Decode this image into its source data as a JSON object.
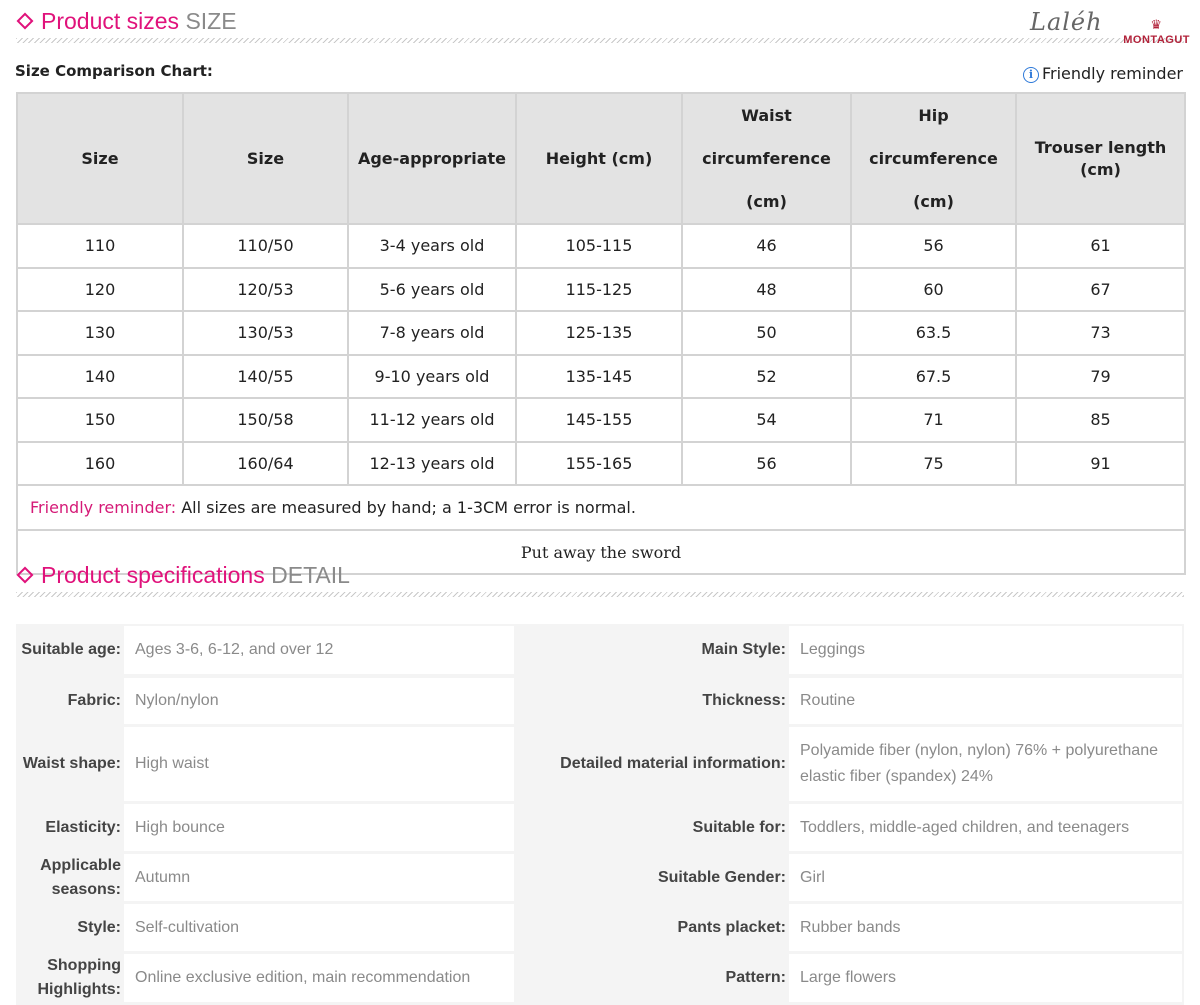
{
  "sizes_section": {
    "title_cn": "Product sizes",
    "title_en": "SIZE"
  },
  "logo": {
    "script": "Laléh",
    "brand": "MONTAGUT",
    "crown": "♛"
  },
  "chart_label": "Size Comparison Chart:",
  "reminder_tag": {
    "icon": "i",
    "label": "Friendly reminder"
  },
  "size_table": {
    "headers": [
      "Size",
      "Size",
      "Age-appropriate",
      "Height (cm)",
      "Waist circumference (cm)",
      "Hip circumference (cm)",
      "Trouser length (cm)"
    ],
    "rows": [
      [
        "110",
        "110/50",
        "3-4 years old",
        "105-115",
        "46",
        "56",
        "61"
      ],
      [
        "120",
        "120/53",
        "5-6 years old",
        "115-125",
        "48",
        "60",
        "67"
      ],
      [
        "130",
        "130/53",
        "7-8 years old",
        "125-135",
        "50",
        "63.5",
        "73"
      ],
      [
        "140",
        "140/55",
        "9-10 years old",
        "135-145",
        "52",
        "67.5",
        "79"
      ],
      [
        "150",
        "150/58",
        "11-12 years old",
        "145-155",
        "54",
        "71",
        "85"
      ],
      [
        "160",
        "160/64",
        "12-13 years old",
        "155-165",
        "56",
        "75",
        "91"
      ]
    ],
    "note_label": "Friendly reminder:",
    "note_text": " All sizes are measured by hand; a 1-3CM error is normal.",
    "tagline": "Put away the sword"
  },
  "spec_section": {
    "title_cn": "Product specifications",
    "title_en": "DETAIL"
  },
  "specs": [
    {
      "l_label": "Suitable age:",
      "l_value": "Ages 3-6, 6-12, and over 12",
      "r_label": "Main Style:",
      "r_value": "Leggings"
    },
    {
      "l_label": "Fabric:",
      "l_value": "Nylon/nylon",
      "r_label": "Thickness:",
      "r_value": "Routine"
    },
    {
      "l_label": "Waist shape:",
      "l_value": "High waist",
      "r_label": "Detailed material information:",
      "r_value": "Polyamide fiber (nylon, nylon) 76% + polyurethane elastic fiber (spandex) 24%"
    },
    {
      "l_label": "Elasticity:",
      "l_value": "High bounce",
      "r_label": "Suitable for:",
      "r_value": "Toddlers, middle-aged children, and teenagers"
    },
    {
      "l_label": "Applicable seasons:",
      "l_value": "Autumn",
      "r_label": "Suitable Gender:",
      "r_value": "Girl"
    },
    {
      "l_label": "Style:",
      "l_value": "Self-cultivation",
      "r_label": "Pants placket:",
      "r_value": "Rubber bands"
    },
    {
      "l_label": "Shopping Highlights:",
      "l_value": "Online exclusive edition, main recommendation",
      "r_label": "Pattern:",
      "r_value": "Large flowers"
    }
  ]
}
